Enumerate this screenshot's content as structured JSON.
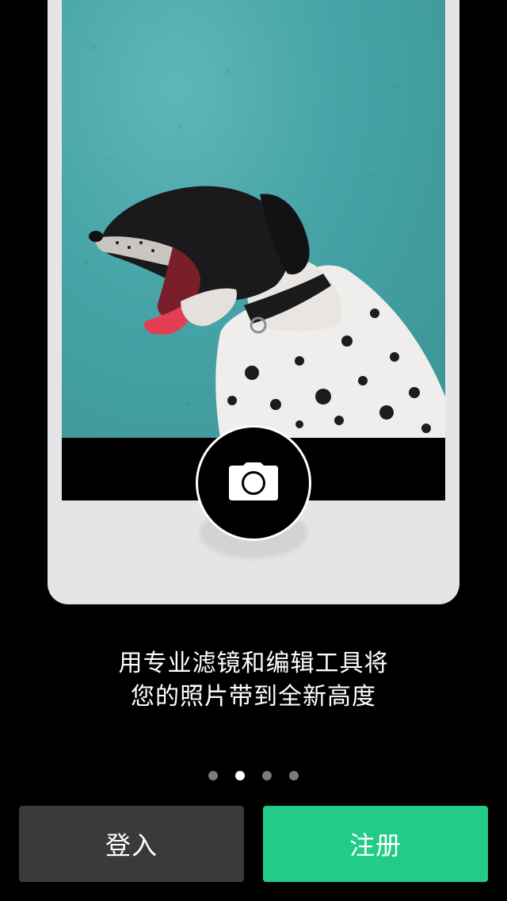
{
  "onboarding": {
    "tagline_line1": "用专业滤镜和编辑工具将",
    "tagline_line2": "您的照片带到全新高度",
    "page_indicator": {
      "total": 4,
      "active_index": 1
    }
  },
  "actions": {
    "login_label": "登入",
    "signup_label": "注册"
  },
  "icons": {
    "shutter": "camera-icon"
  },
  "colors": {
    "background": "#000000",
    "login_button": "#3a393b",
    "signup_button": "#22cc88",
    "phone_frame": "#e6e4e6",
    "photo_wall": "#46a3a6"
  }
}
